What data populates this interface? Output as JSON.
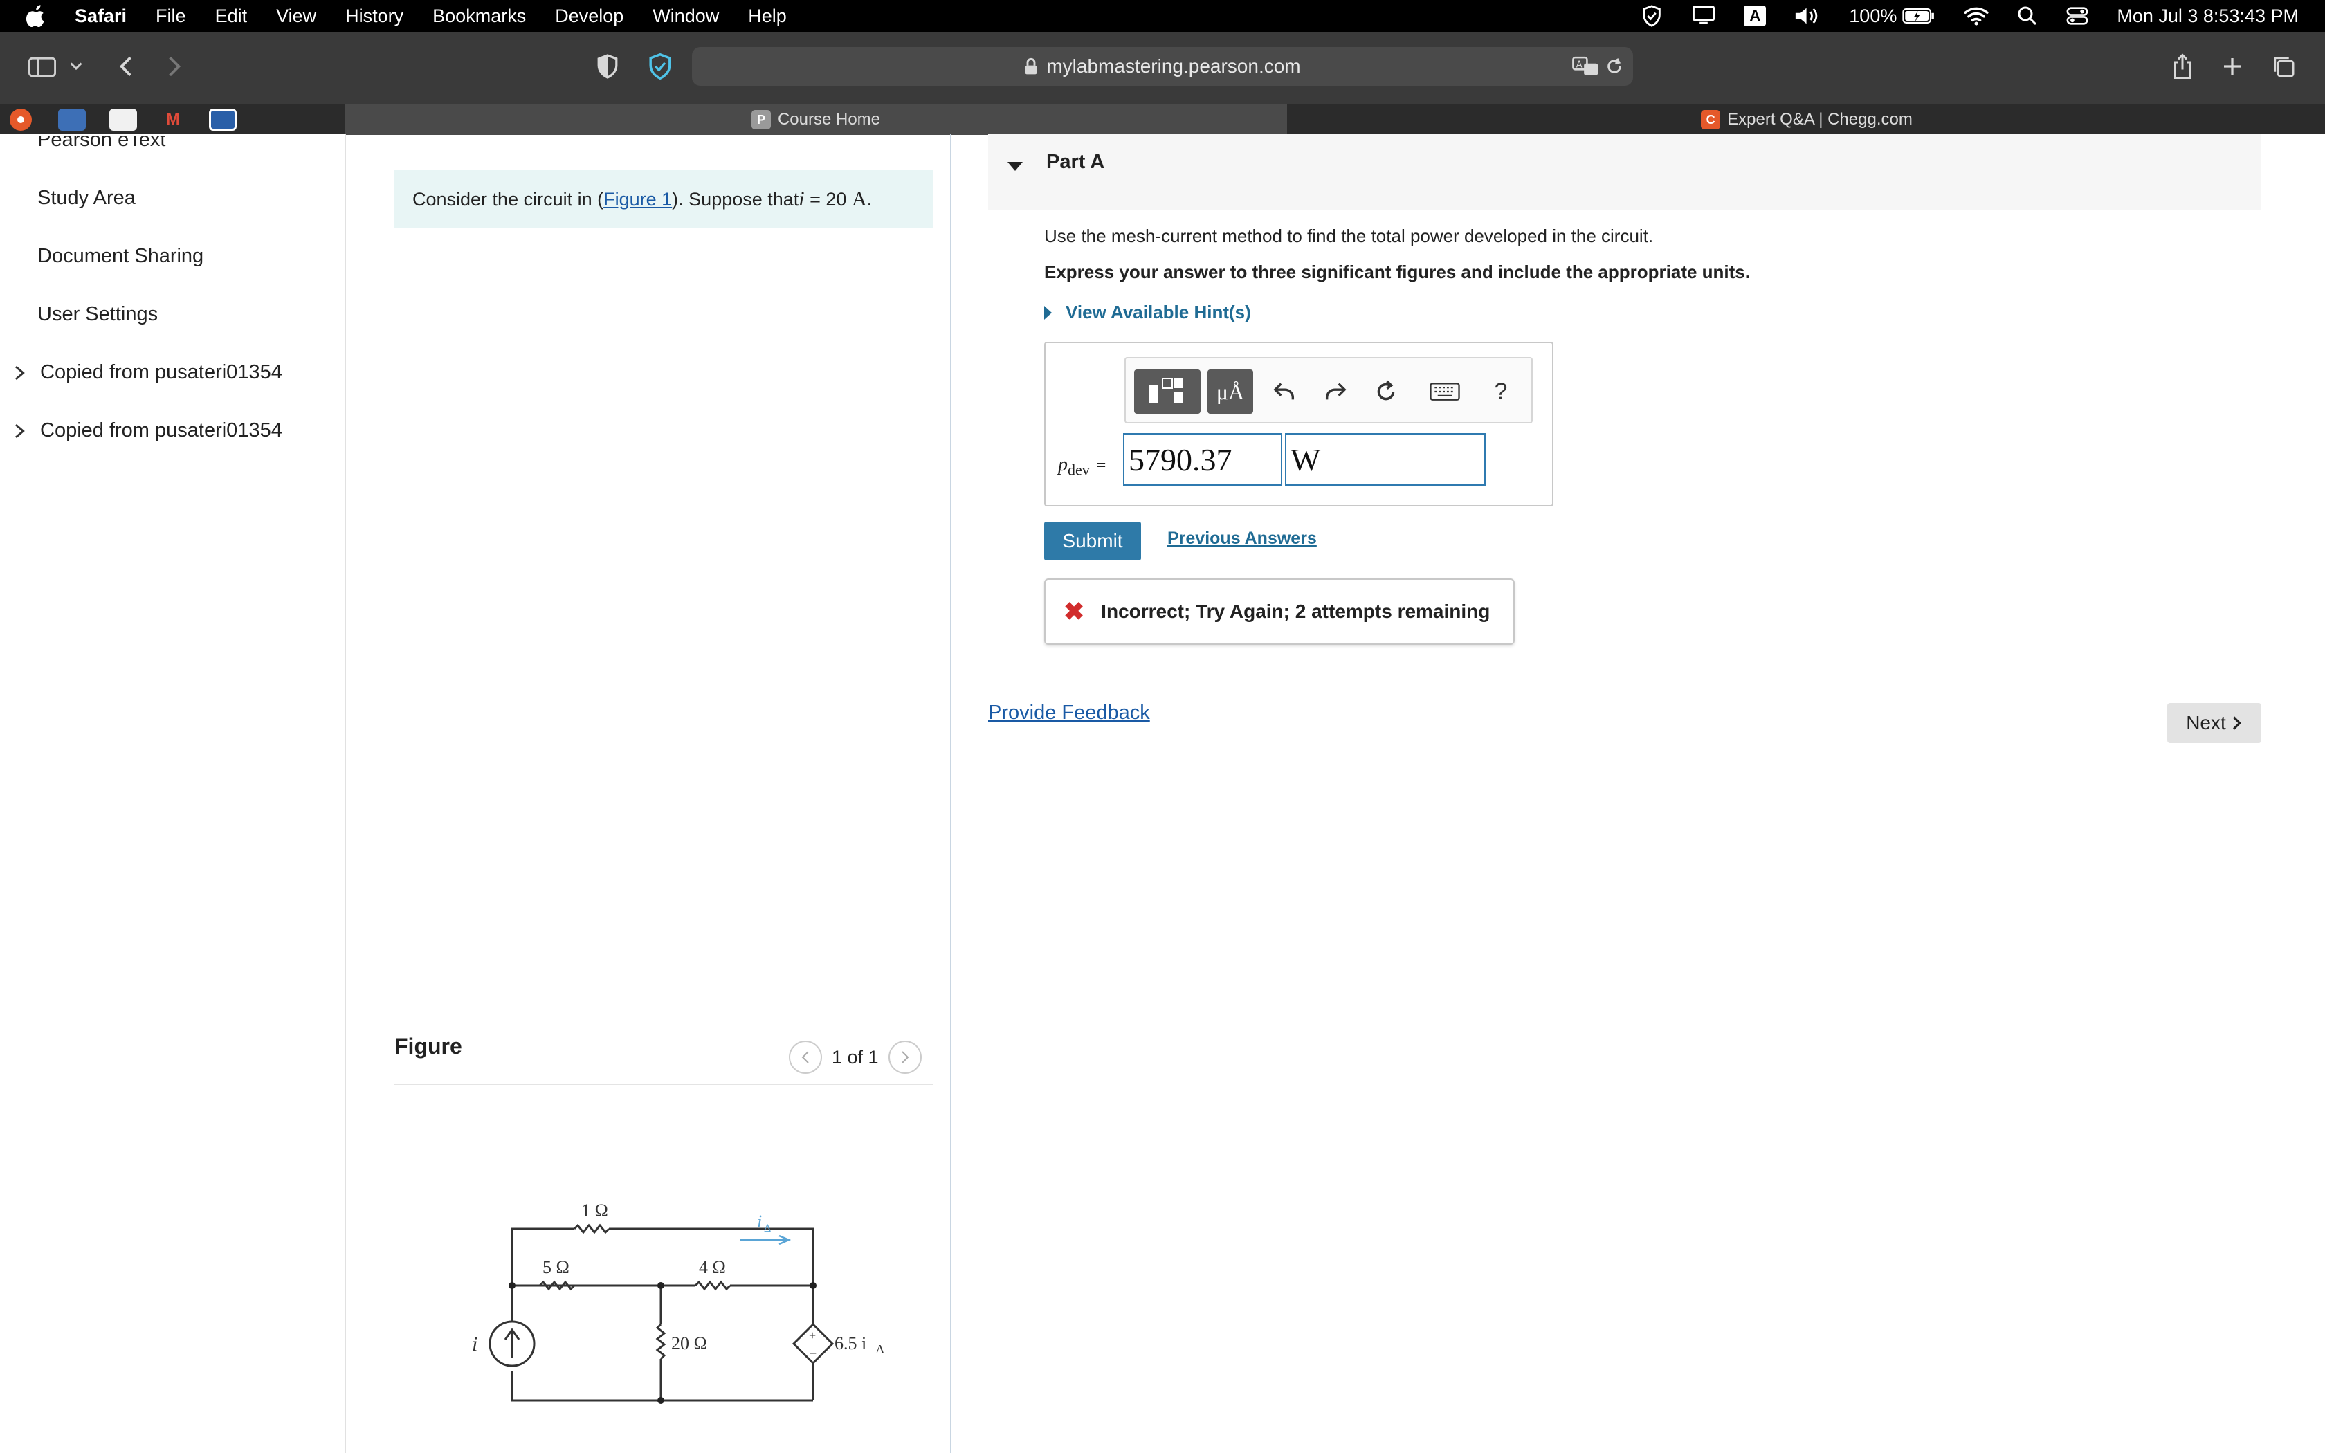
{
  "menubar": {
    "app": "Safari",
    "items": [
      "File",
      "Edit",
      "View",
      "History",
      "Bookmarks",
      "Develop",
      "Window",
      "Help"
    ],
    "input_source": "A",
    "battery": "100%",
    "clock": "Mon Jul 3  8:53:43 PM"
  },
  "toolbar": {
    "url": "mylabmastering.pearson.com"
  },
  "tabs": {
    "items": [
      {
        "label": "Course Home",
        "badge": "P",
        "badge_color": "#9a9a9a"
      },
      {
        "label": "Expert Q&A | Chegg.com",
        "badge": "C",
        "badge_color": "#e5592a"
      }
    ]
  },
  "sidebar": {
    "cut_item": "Pearson eText",
    "items": [
      "Study Area",
      "Document Sharing",
      "User Settings"
    ],
    "groups": [
      "Copied from pusateri01354",
      "Copied from pusateri01354"
    ]
  },
  "question": {
    "text_before": "Consider the circuit in (",
    "link": "Figure 1",
    "text_after": "). Suppose that ",
    "var": "i",
    "eq": " = 20 ",
    "unit": "A",
    "end": "."
  },
  "figure": {
    "title": "Figure",
    "pager": "1 of 1",
    "labels": {
      "r1": "1 Ω",
      "r5": "5 Ω",
      "r4": "4 Ω",
      "r20": "20 Ω",
      "source": "i",
      "dep": "6.5 i",
      "dep_sub": "Δ",
      "current": "i",
      "current_sub": "Δ"
    }
  },
  "part": {
    "label": "Part A",
    "question": "Use the mesh-current method to find the total power developed in the circuit.",
    "instruction": "Express your answer to three significant figures and include the appropriate units.",
    "hint": "View Available Hint(s)",
    "answer_var": "p",
    "answer_sub": "dev",
    "answer_eq": "=",
    "value": "5790.37",
    "unit": "W",
    "tools": {
      "units_label": "μÅ",
      "help": "?"
    },
    "submit": "Submit",
    "previous": "Previous Answers",
    "feedback": "Incorrect; Try Again; 2 attempts remaining"
  },
  "footer": {
    "provide_feedback": "Provide Feedback",
    "next": "Next"
  }
}
